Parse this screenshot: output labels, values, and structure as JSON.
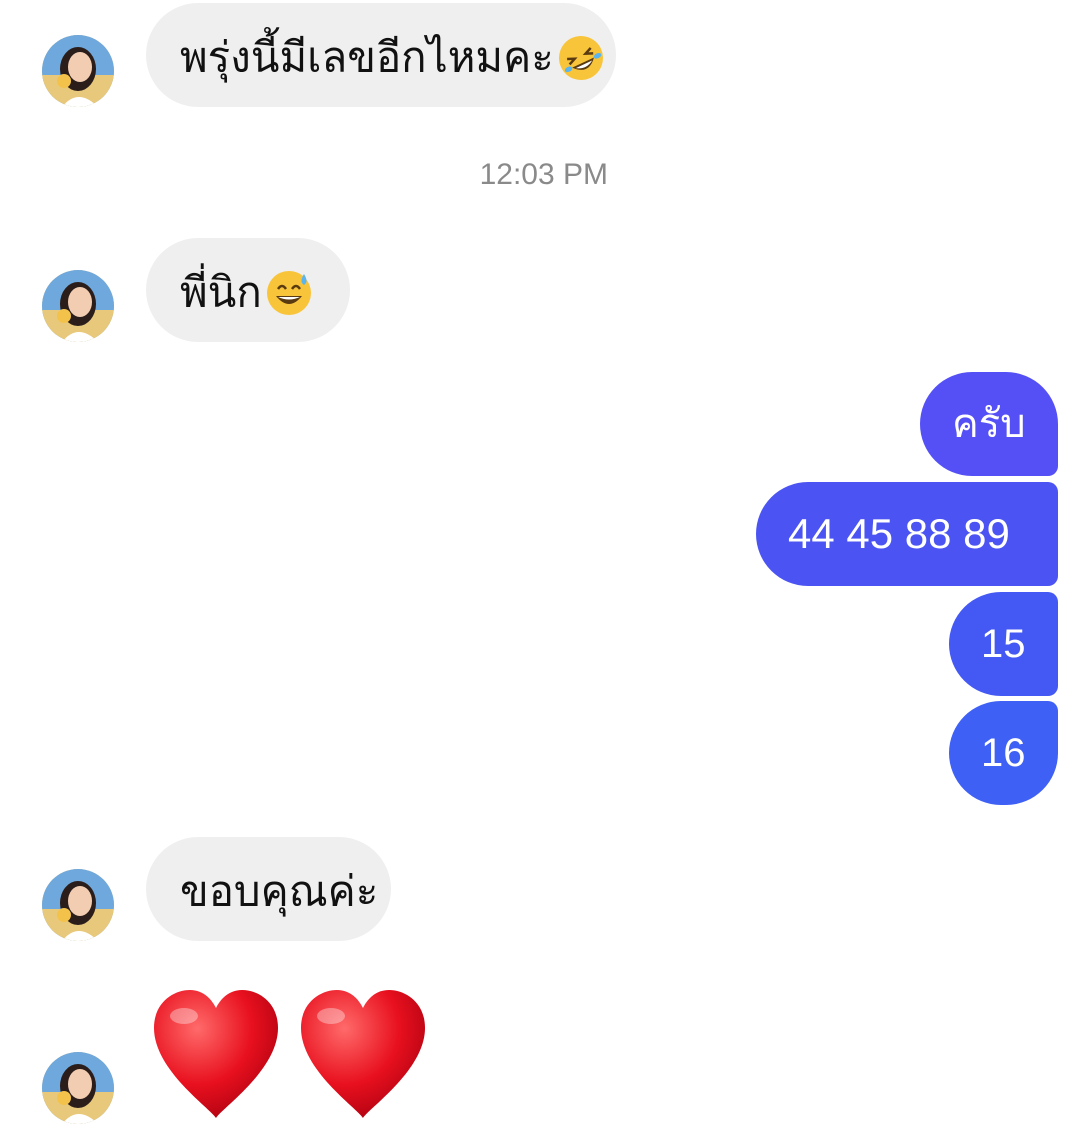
{
  "conversation": {
    "messages": [
      {
        "direction": "incoming",
        "text": "พรุ่งนี้มีเลขอีกไหมคะ",
        "emoji": "rolling-on-floor-laughing"
      },
      {
        "direction": "incoming",
        "text": "พี่นิก",
        "emoji": "grinning-sweat"
      },
      {
        "direction": "outgoing",
        "text": "ครับ"
      },
      {
        "direction": "outgoing",
        "text": "44 45 88 89"
      },
      {
        "direction": "outgoing",
        "text": "15"
      },
      {
        "direction": "outgoing",
        "text": "16"
      },
      {
        "direction": "incoming",
        "text": "ขอบคุณค่ะ"
      },
      {
        "direction": "incoming",
        "emoji": "red-heart x2"
      }
    ],
    "timestamp": "12:03 PM"
  },
  "colors": {
    "incoming_bubble": "#efefef",
    "outgoing_gradient": [
      "#5b4ff5",
      "#4a52f0",
      "#3d62f5"
    ],
    "timestamp": "#8a8a8a"
  }
}
